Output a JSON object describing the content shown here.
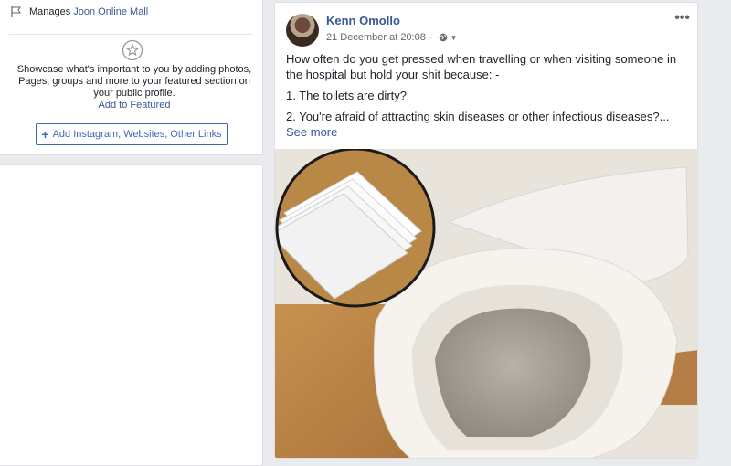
{
  "profile_sidebar": {
    "manages_label": "Manages",
    "managed_page": "Joon Online Mall",
    "featured_description": "Showcase what's important to you by adding photos, Pages, groups and more to your featured section on your public profile.",
    "add_to_featured": "Add to Featured",
    "add_links_button": "Add Instagram, Websites, Other Links"
  },
  "post": {
    "author": "Kenn Omollo",
    "timestamp": "21 December at 20:08",
    "privacy_icon": "globe-icon",
    "menu_icon": "more-icon",
    "more_glyph": "•••",
    "text_intro": "How often do you get pressed when travelling or when visiting someone in the hospital but hold your shit because: -",
    "text_item_1": "1. The toilets are dirty?",
    "text_item_2": "2. You're afraid of attracting skin diseases or other infectious diseases?...",
    "see_more": "See more"
  },
  "colors": {
    "background": "#e9ebee",
    "link": "#385898",
    "button_border": "#4267b2"
  }
}
